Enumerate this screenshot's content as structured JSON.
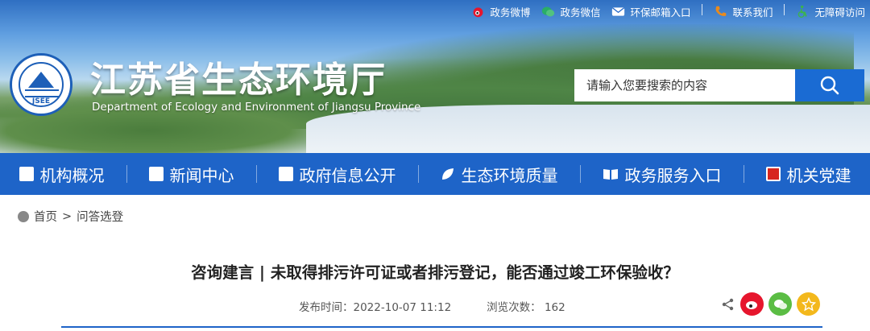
{
  "topbar": {
    "links": [
      {
        "label": "政务微博",
        "icon": "weibo-icon",
        "color": "#e6162d"
      },
      {
        "label": "政务微信",
        "icon": "wechat-icon",
        "color": "#2aae67"
      },
      {
        "label": "环保邮箱入口",
        "icon": "mail-icon",
        "color": "#ffffff"
      },
      {
        "label": "联系我们",
        "icon": "phone-icon",
        "color": "#e98a1c"
      },
      {
        "label": "无障碍访问",
        "icon": "accessibility-icon",
        "color": "#3bb54a"
      }
    ]
  },
  "header": {
    "logo_text": "JSEE",
    "title": "江苏省生态环境厅",
    "subtitle": "Department of Ecology and Environment of Jiangsu Province"
  },
  "search": {
    "placeholder": "请输入您要搜索的内容",
    "button_icon": "search-icon",
    "accent": "#1a6bd3"
  },
  "nav": {
    "color": "#1e64c8",
    "items": [
      {
        "label": "机构概况",
        "icon": "document-icon"
      },
      {
        "label": "新闻中心",
        "icon": "news-icon"
      },
      {
        "label": "政府信息公开",
        "icon": "list-icon"
      },
      {
        "label": "生态环境质量",
        "icon": "leaf-icon"
      },
      {
        "label": "政务服务入口",
        "icon": "book-icon"
      },
      {
        "label": "机关党建",
        "icon": "party-flag-icon"
      }
    ]
  },
  "breadcrumb": {
    "home": "首页",
    "separator": ">",
    "current": "问答选登"
  },
  "article": {
    "title": "咨询建言 | 未取得排污许可证或者排污登记，能否通过竣工环保验收？",
    "publish_label": "发布时间：",
    "publish_time": "2022-10-07 11:12",
    "views_label": "浏览次数：",
    "views": "162"
  },
  "share": {
    "buttons": [
      {
        "icon": "share-icon"
      },
      {
        "icon": "weibo-icon",
        "color": "#e6162d"
      },
      {
        "icon": "wechat-icon",
        "color": "#5bbd44"
      },
      {
        "icon": "favorite-icon",
        "color": "#f3b81c"
      }
    ]
  }
}
